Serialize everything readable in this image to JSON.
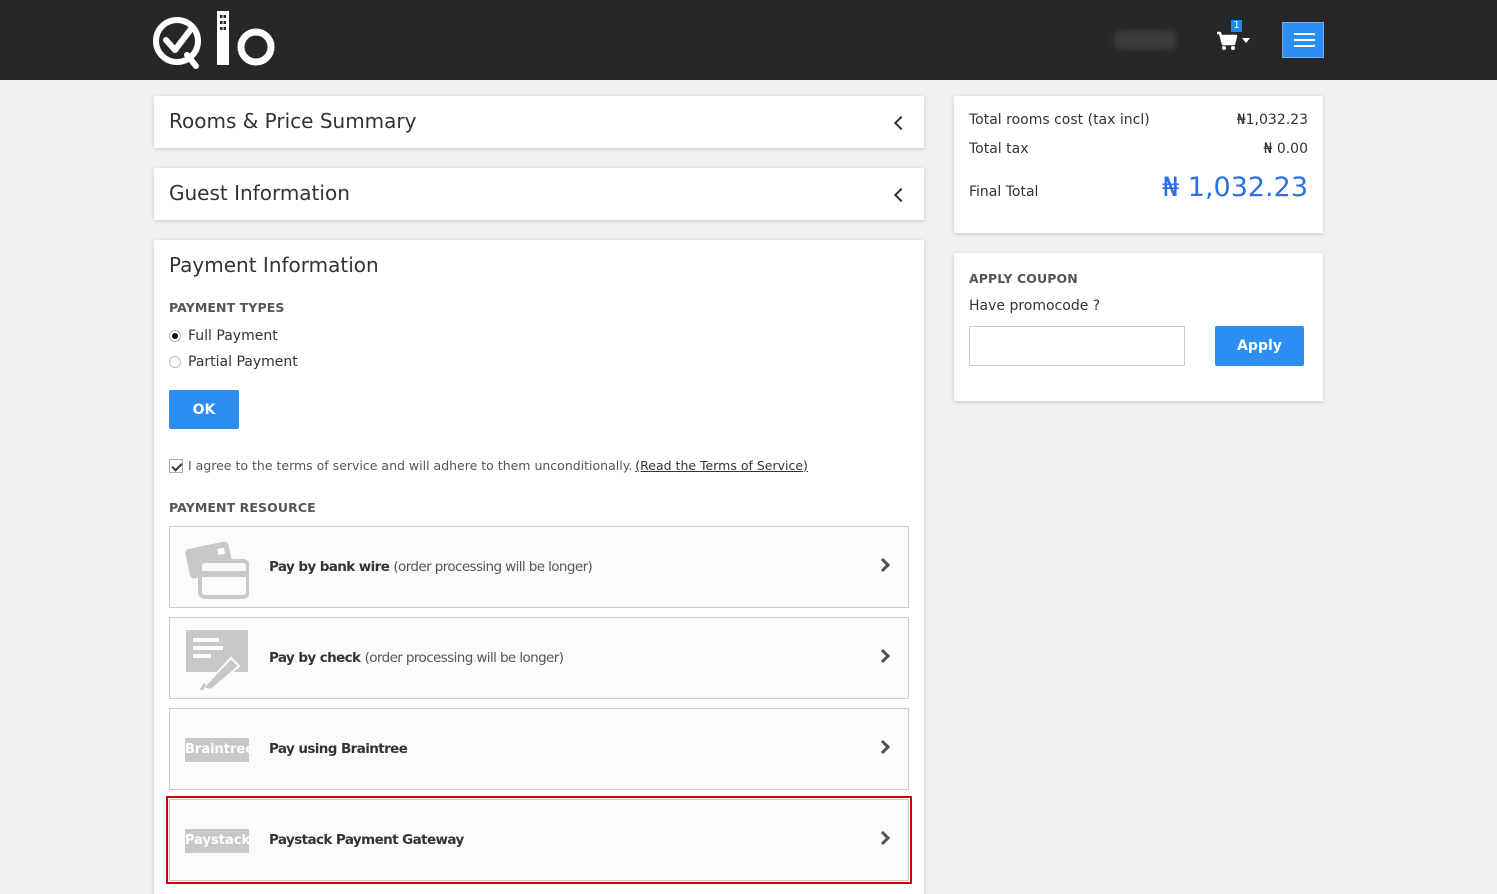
{
  "header": {
    "cart_count": "1"
  },
  "accordions": [
    {
      "title": "Rooms & Price Summary"
    },
    {
      "title": "Guest Information"
    }
  ],
  "payment": {
    "title": "Payment Information",
    "types_heading": "PAYMENT TYPES",
    "types": [
      {
        "label": "Full Payment",
        "selected": true
      },
      {
        "label": "Partial Payment",
        "selected": false
      }
    ],
    "ok_label": "OK",
    "terms_text": "I agree to the terms of service and will adhere to them unconditionally.",
    "terms_link": "(Read the Terms of Service)",
    "resource_heading": "PAYMENT RESOURCE",
    "options": [
      {
        "label": "Pay by bank wire",
        "sub": "(order processing will be longer)",
        "icon": "bank-card-icon"
      },
      {
        "label": "Pay by check",
        "sub": "(order processing will be longer)",
        "icon": "check-pen-icon"
      },
      {
        "label": "Pay using Braintree",
        "sub": "",
        "badge": "Braintree"
      },
      {
        "label": "Paystack Payment Gateway",
        "sub": "",
        "badge": "Paystack",
        "highlighted": true
      }
    ]
  },
  "summary": {
    "rooms_label": "Total rooms cost (tax incl)",
    "rooms_value": "₦1,032.23",
    "tax_label": "Total tax",
    "tax_value": "₦ 0.00",
    "final_label": "Final Total",
    "final_value": "₦ 1,032.23"
  },
  "coupon": {
    "heading": "APPLY COUPON",
    "prompt": "Have promocode ?",
    "input_value": "",
    "apply_label": "Apply"
  },
  "colors": {
    "topbar": "#272727",
    "accent": "#2b8ef0",
    "total": "#2d6fe6",
    "highlight": "#d60000"
  }
}
